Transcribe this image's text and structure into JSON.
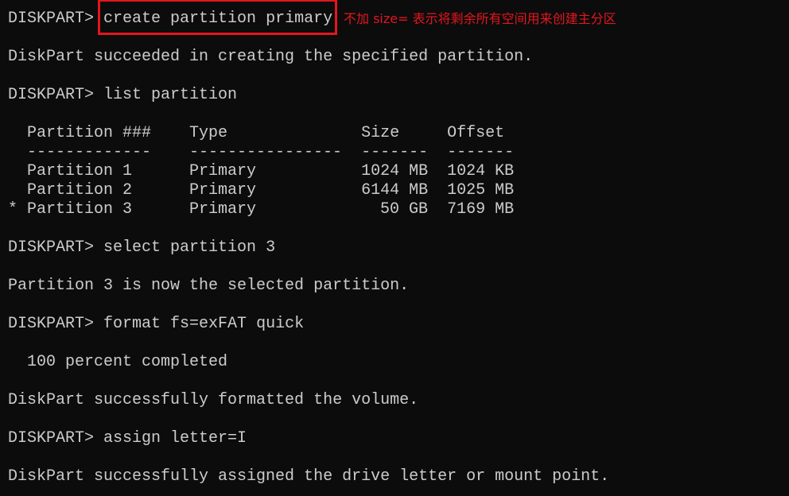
{
  "terminal": {
    "prompt": "DISKPART> ",
    "cmd1": "create partition primary",
    "annotation": "不加 size= 表示将剩余所有空间用来创建主分区",
    "out1": "DiskPart succeeded in creating the specified partition.",
    "cmd2": "list partition",
    "table": {
      "headers": [
        "Partition ###",
        "Type",
        "Size",
        "Offset"
      ],
      "dashes": [
        "-------------",
        "----------------",
        "-------",
        "-------"
      ],
      "rows": [
        {
          "marker": " ",
          "partition": "Partition 1",
          "type": "Primary",
          "size": "1024 MB",
          "offset": "1024 KB"
        },
        {
          "marker": " ",
          "partition": "Partition 2",
          "type": "Primary",
          "size": "6144 MB",
          "offset": "1025 MB"
        },
        {
          "marker": "*",
          "partition": "Partition 3",
          "type": "Primary",
          "size": "50 GB",
          "offset": "7169 MB"
        }
      ]
    },
    "cmd3": "select partition 3",
    "out3": "Partition 3 is now the selected partition.",
    "cmd4": "format fs=exFAT quick",
    "out4a": "  100 percent completed",
    "out4b": "DiskPart successfully formatted the volume.",
    "cmd5": "assign letter=I",
    "out5": "DiskPart successfully assigned the drive letter or mount point."
  },
  "colors": {
    "background": "#0c0c0c",
    "text": "#cccccc",
    "highlight": "#e3161e"
  }
}
